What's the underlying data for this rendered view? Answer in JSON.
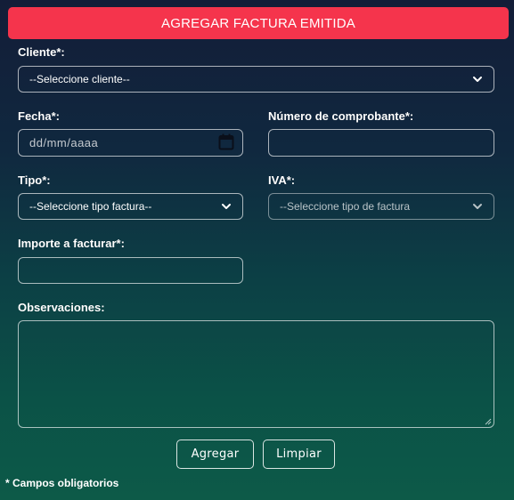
{
  "header": {
    "title": "AGREGAR FACTURA EMITIDA"
  },
  "form": {
    "cliente": {
      "label": "Cliente*:",
      "selected": "--Seleccione cliente--"
    },
    "fecha": {
      "label": "Fecha*:",
      "placeholder": "dd/mm/aaaa"
    },
    "numero": {
      "label": "Número de comprobante*:",
      "value": ""
    },
    "tipo": {
      "label": "Tipo*:",
      "selected": "--Seleccione tipo factura--"
    },
    "iva": {
      "label": "IVA*:",
      "selected": "--Seleccione tipo de factura"
    },
    "importe": {
      "label": "Importe a facturar*:",
      "value": ""
    },
    "observaciones": {
      "label": "Observaciones:",
      "value": ""
    }
  },
  "buttons": {
    "agregar": "Agregar",
    "limpiar": "Limpiar"
  },
  "footnote": "* Campos obligatorios",
  "colors": {
    "accent": "#f5344c",
    "bg_top": "#131d38",
    "bg_bottom": "#0d5a48"
  },
  "icons": [
    "chevron-down-icon",
    "calendar-icon",
    "resize-handle-icon"
  ]
}
